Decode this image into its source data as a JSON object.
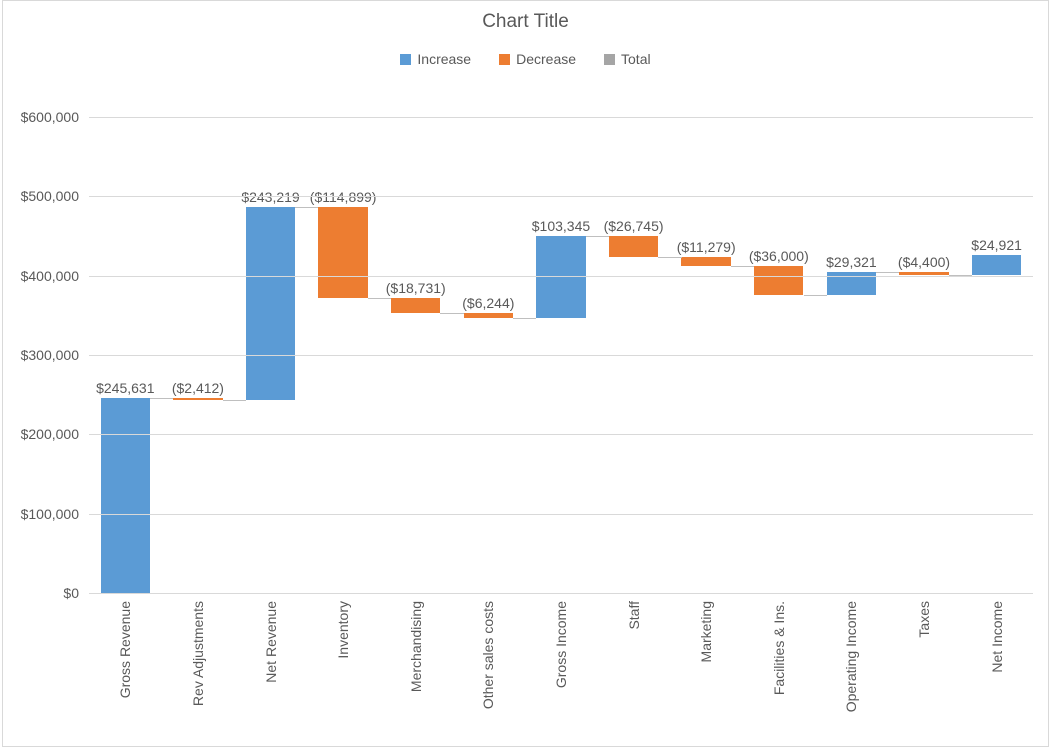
{
  "chart_data": {
    "type": "waterfall",
    "title": "Chart Title",
    "legend": [
      "Increase",
      "Decrease",
      "Total"
    ],
    "ylabel": "",
    "xlabel": "",
    "ylim": [
      0,
      600000
    ],
    "y_ticks": [
      0,
      100000,
      200000,
      300000,
      400000,
      500000,
      600000
    ],
    "y_tick_labels": [
      "$0",
      "$100,000",
      "$200,000",
      "$300,000",
      "$400,000",
      "$500,000",
      "$600,000"
    ],
    "items": [
      {
        "name": "Gross Revenue",
        "kind": "increase",
        "value": 245631,
        "prev": 0,
        "cum": 245631,
        "label": "$245,631"
      },
      {
        "name": "Rev Adjustments",
        "kind": "decrease",
        "value": 2412,
        "prev": 245631,
        "cum": 243219,
        "label": "($2,412)"
      },
      {
        "name": "Net Revenue",
        "kind": "increase",
        "value": 243219,
        "prev": 243219,
        "cum": 486438,
        "label": "$243,219"
      },
      {
        "name": "Inventory",
        "kind": "decrease",
        "value": 114899,
        "prev": 486438,
        "cum": 371539,
        "label": "($114,899)"
      },
      {
        "name": "Merchandising",
        "kind": "decrease",
        "value": 18731,
        "prev": 371539,
        "cum": 352808,
        "label": "($18,731)"
      },
      {
        "name": "Other sales costs",
        "kind": "decrease",
        "value": 6244,
        "prev": 352808,
        "cum": 346564,
        "label": "($6,244)"
      },
      {
        "name": "Gross Income",
        "kind": "increase",
        "value": 103345,
        "prev": 346564,
        "cum": 449909,
        "label": "$103,345"
      },
      {
        "name": "Staff",
        "kind": "decrease",
        "value": 26745,
        "prev": 449909,
        "cum": 423164,
        "label": "($26,745)"
      },
      {
        "name": "Marketing",
        "kind": "decrease",
        "value": 11279,
        "prev": 423164,
        "cum": 411885,
        "label": "($11,279)"
      },
      {
        "name": "Facilities & Ins.",
        "kind": "decrease",
        "value": 36000,
        "prev": 411885,
        "cum": 375885,
        "label": "($36,000)"
      },
      {
        "name": "Operating Income",
        "kind": "increase",
        "value": 29321,
        "prev": 375885,
        "cum": 405206,
        "label": "$29,321"
      },
      {
        "name": "Taxes",
        "kind": "decrease",
        "value": 4400,
        "prev": 405206,
        "cum": 400806,
        "label": "($4,400)"
      },
      {
        "name": "Net Income",
        "kind": "increase",
        "value": 24921,
        "prev": 400806,
        "cum": 425727,
        "label": "$24,921"
      }
    ]
  },
  "colors": {
    "increase": "#5b9bd5",
    "decrease": "#ed7d31",
    "total": "#a5a5a5"
  }
}
